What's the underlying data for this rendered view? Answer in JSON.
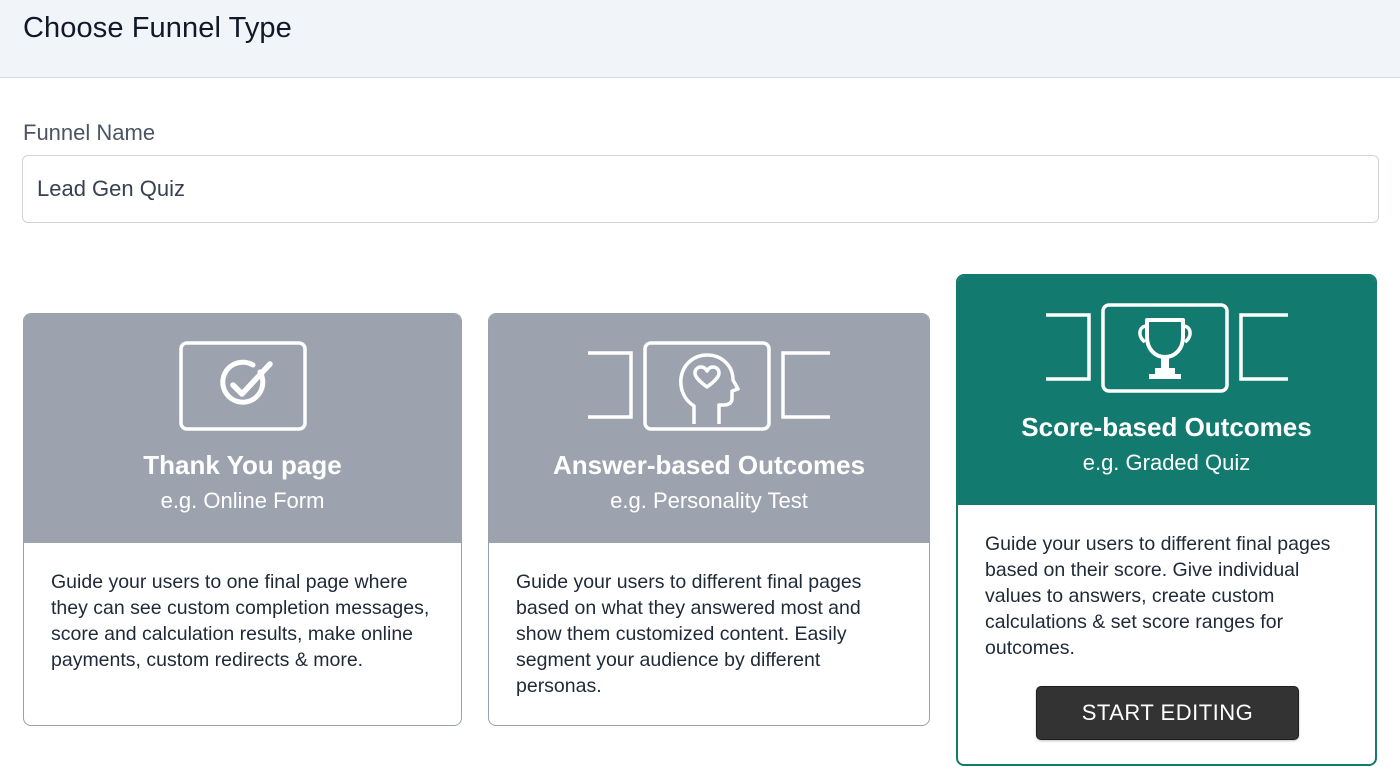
{
  "header": {
    "title": "Choose Funnel Type"
  },
  "form": {
    "name_label": "Funnel Name",
    "name_value": "Lead Gen Quiz"
  },
  "colors": {
    "selected": "#127a6e",
    "unselected": "#9ca3af",
    "button": "#333333"
  },
  "cards": [
    {
      "icon": "checkmark-icon",
      "title": "Thank You page",
      "subtitle": "e.g. Online Form",
      "description": "Guide your users to one final page where they can see custom completion messages, score and calculation results, make online payments, custom redirects & more.",
      "selected": false
    },
    {
      "icon": "head-heart-icon",
      "title": "Answer-based Outcomes",
      "subtitle": "e.g. Personality Test",
      "description": "Guide your users to different final pages based on what they answered most and show them customized content. Easily segment your audience by different personas.",
      "selected": false
    },
    {
      "icon": "trophy-icon",
      "title": "Score-based Outcomes",
      "subtitle": "e.g. Graded Quiz",
      "description": "Guide your users to different final pages based on their score. Give individual values to answers, create custom calculations & set score ranges for outcomes.",
      "selected": true,
      "button_label": "START EDITING"
    }
  ]
}
